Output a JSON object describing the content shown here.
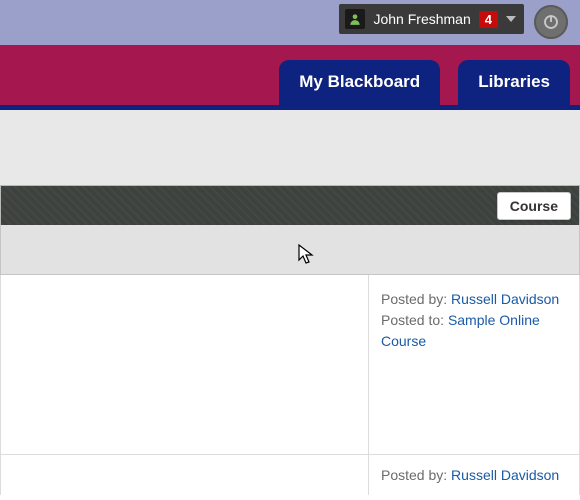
{
  "topbar": {
    "user_name": "John Freshman",
    "notification_count": "4"
  },
  "nav": {
    "tabs": [
      {
        "label": "My Blackboard",
        "active": true
      },
      {
        "label": "Libraries",
        "active": false
      }
    ]
  },
  "panel": {
    "course_button": "Course"
  },
  "posts": [
    {
      "posted_by_label": "Posted by:",
      "author": "Russell Davidson",
      "posted_to_label": "Posted to:",
      "destination": "Sample Online Course"
    },
    {
      "posted_by_label": "Posted by:",
      "author": "Russell Davidson"
    }
  ]
}
